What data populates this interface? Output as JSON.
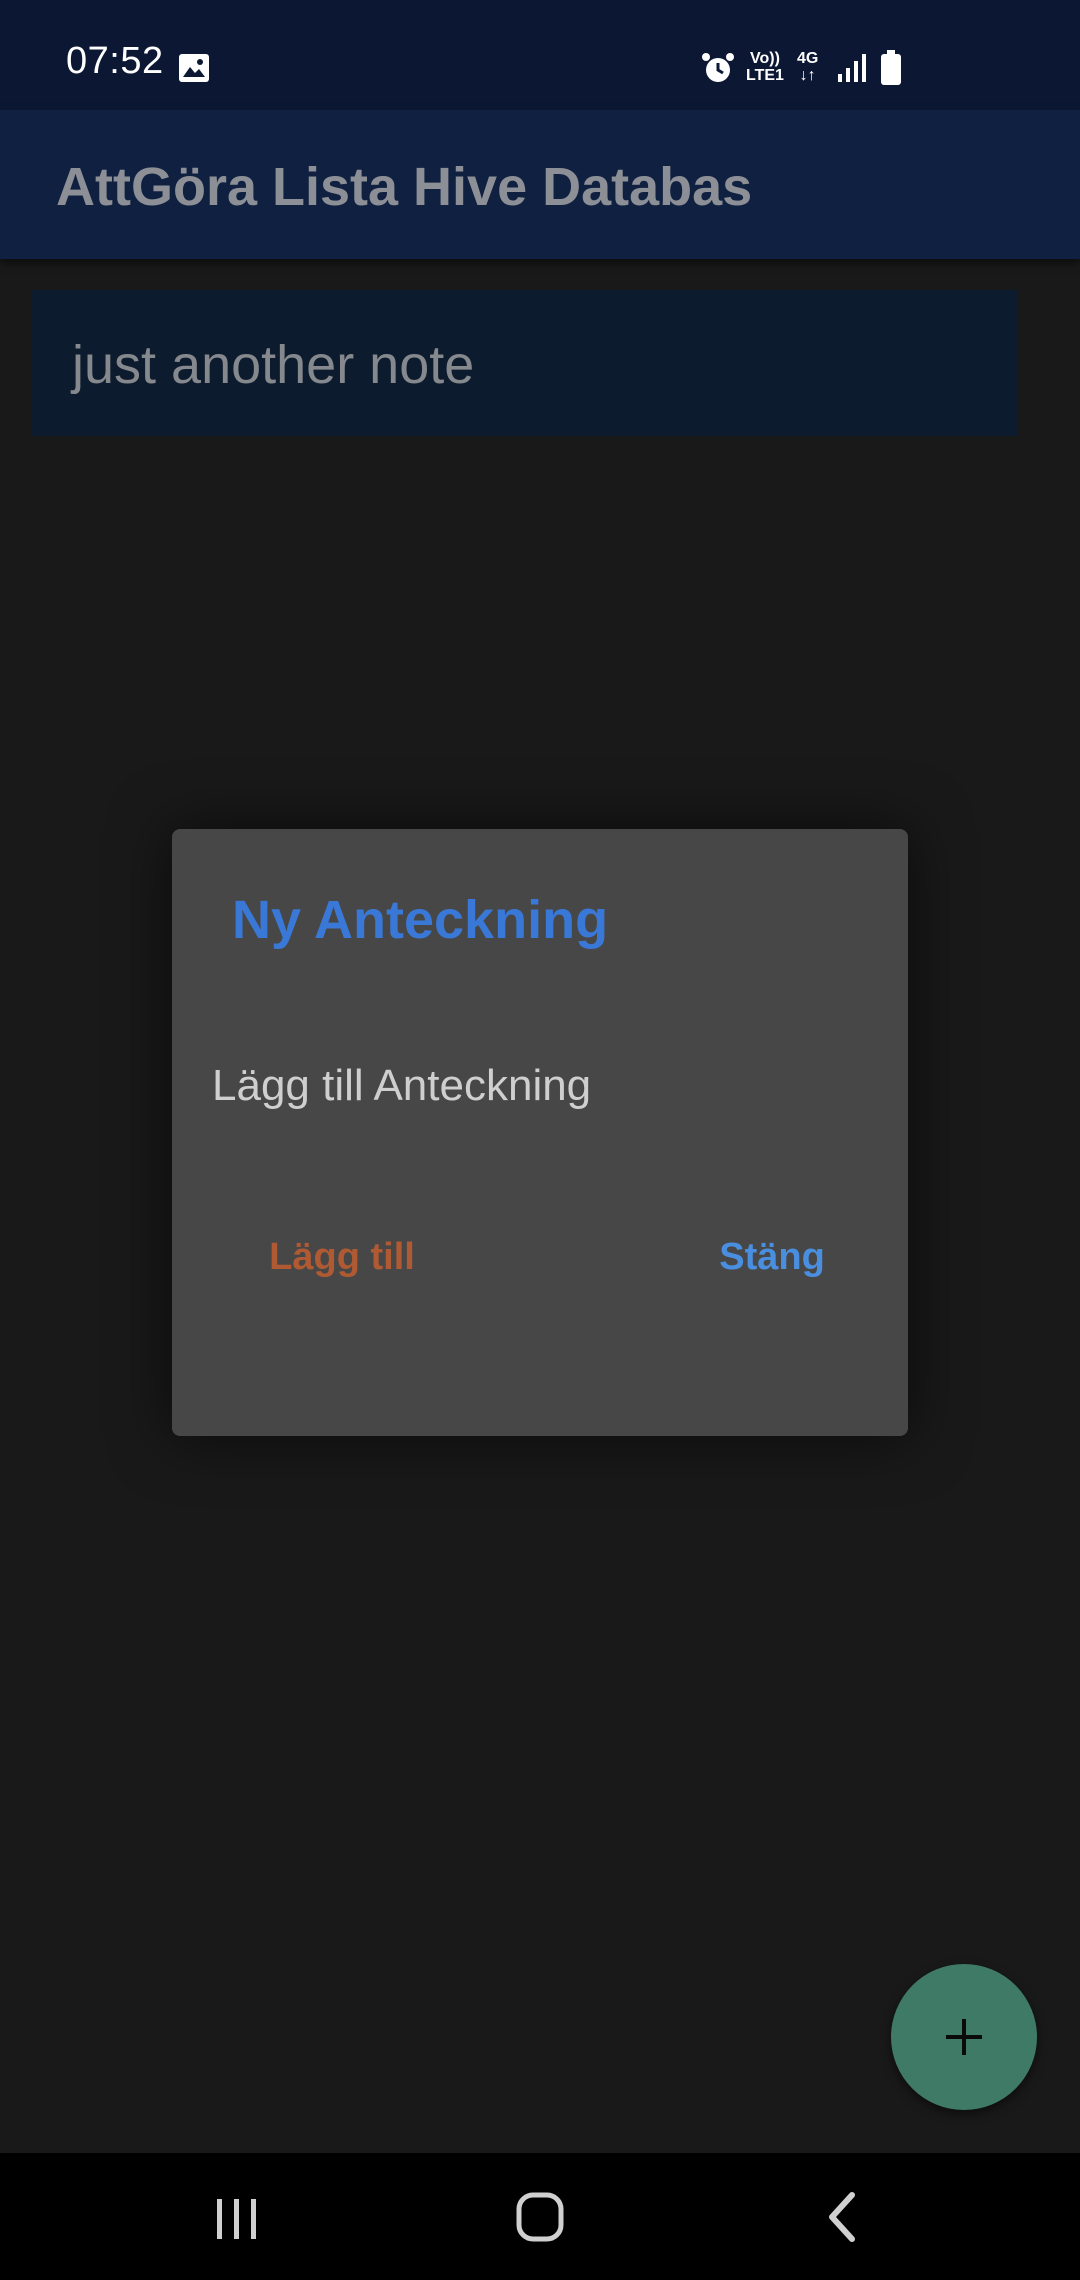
{
  "status_bar": {
    "time": "07:52",
    "icons": [
      "gallery-icon",
      "alarm-icon",
      "volte-icon",
      "4g-icon",
      "signal-icon",
      "battery-icon"
    ],
    "volte_line1": "Vo))",
    "volte_line2": "LTE1",
    "network_type": "4G",
    "network_arrows": "↓↑"
  },
  "app_bar": {
    "title": "AttGöra Lista Hive Databas"
  },
  "notes": [
    {
      "text": "just another note"
    }
  ],
  "dialog": {
    "title": "Ny Anteckning",
    "content": "Lägg till Anteckning",
    "add_label": "Lägg till",
    "close_label": "Stäng"
  },
  "fab": {
    "icon": "plus-icon"
  },
  "nav_bar": {
    "icons": [
      "recents-icon",
      "home-icon",
      "back-icon"
    ]
  },
  "colors": {
    "background": "#191919",
    "status_bar": "#0c1833",
    "app_bar": "#0f2041",
    "note_card": "#0c1b2d",
    "dialog": "#474747",
    "dialog_title": "#3a78d8",
    "add_button": "#b05a33",
    "close_button": "#4a8ee0",
    "fab": "#3f7a67"
  }
}
